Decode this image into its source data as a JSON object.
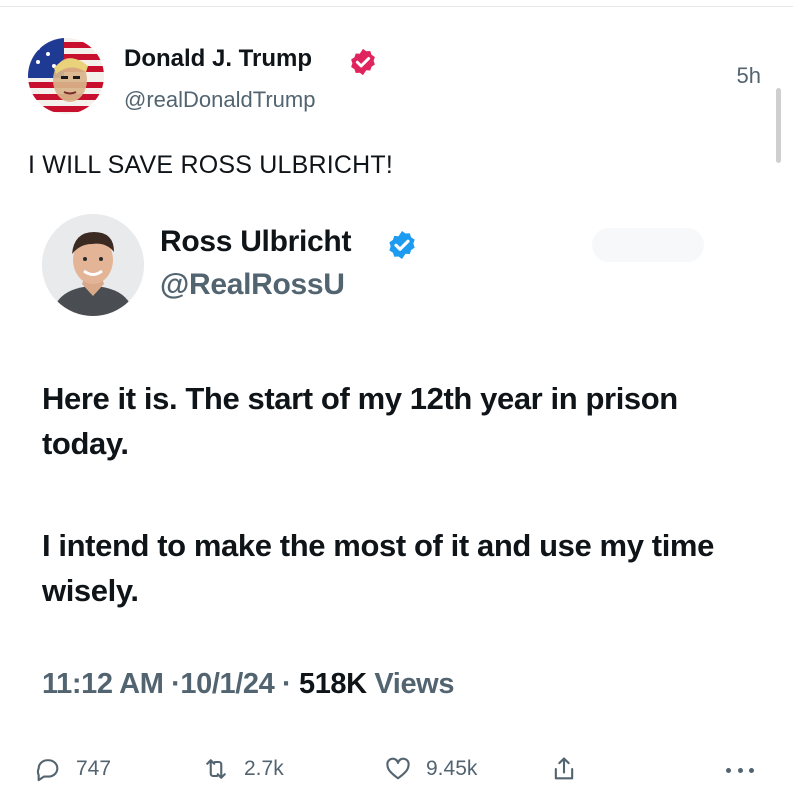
{
  "post": {
    "author": {
      "name": "Donald J. Trump",
      "handle": "@realDonaldTrump",
      "badge_color": "#e0245e",
      "avatar_icon": "flag-portrait-avatar"
    },
    "timestamp": "5h",
    "text": "I WILL SAVE ROSS ULBRICHT!"
  },
  "quoted": {
    "author": {
      "name": "Ross Ulbricht",
      "handle": "@RealRossU",
      "badge_color": "#1d9bf0",
      "avatar_icon": "person-photo-avatar"
    },
    "paragraphs": [
      "Here it is. The start of my 12th year in prison today.",
      "I intend to make the most of it and use my time wisely."
    ],
    "meta": {
      "time": "11:12 AM",
      "separator": "·",
      "date": "10/1/24",
      "views_count": "518K",
      "views_label": "Views"
    }
  },
  "actions": {
    "replies": "747",
    "reposts": "2.7k",
    "likes": "9.45k",
    "icons": [
      "reply-icon",
      "repost-icon",
      "like-icon",
      "share-icon",
      "more-icon"
    ]
  },
  "colors": {
    "text_primary": "#0f1419",
    "text_secondary": "#536471"
  }
}
